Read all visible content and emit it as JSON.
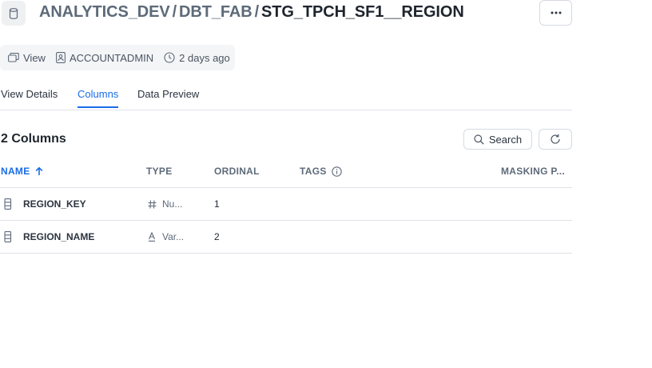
{
  "header": {
    "breadcrumb": [
      "ANALYTICS_DEV",
      "DBT_FAB"
    ],
    "separator": "/",
    "current": "STG_TPCH_SF1__REGION"
  },
  "meta": {
    "object_type": "View",
    "owner": "ACCOUNTADMIN",
    "modified": "2 days ago"
  },
  "tabs": [
    {
      "label": "View Details",
      "active": false
    },
    {
      "label": "Columns",
      "active": true
    },
    {
      "label": "Data Preview",
      "active": false
    }
  ],
  "columns_section": {
    "count_label": "2 Columns",
    "search_label": "Search"
  },
  "table": {
    "headers": {
      "name": "NAME",
      "type": "TYPE",
      "ordinal": "ORDINAL",
      "tags": "TAGS",
      "masking": "MASKING P..."
    },
    "rows": [
      {
        "name": "REGION_KEY",
        "type_icon": "hash-icon",
        "type": "Nu...",
        "ordinal": "1"
      },
      {
        "name": "REGION_NAME",
        "type_icon": "text-type-icon",
        "type": "Var...",
        "ordinal": "2"
      }
    ]
  },
  "colors": {
    "accent": "#1a6ce7",
    "text": "#1e252d",
    "muted": "#5d6a79",
    "border": "#dfe3e8"
  }
}
